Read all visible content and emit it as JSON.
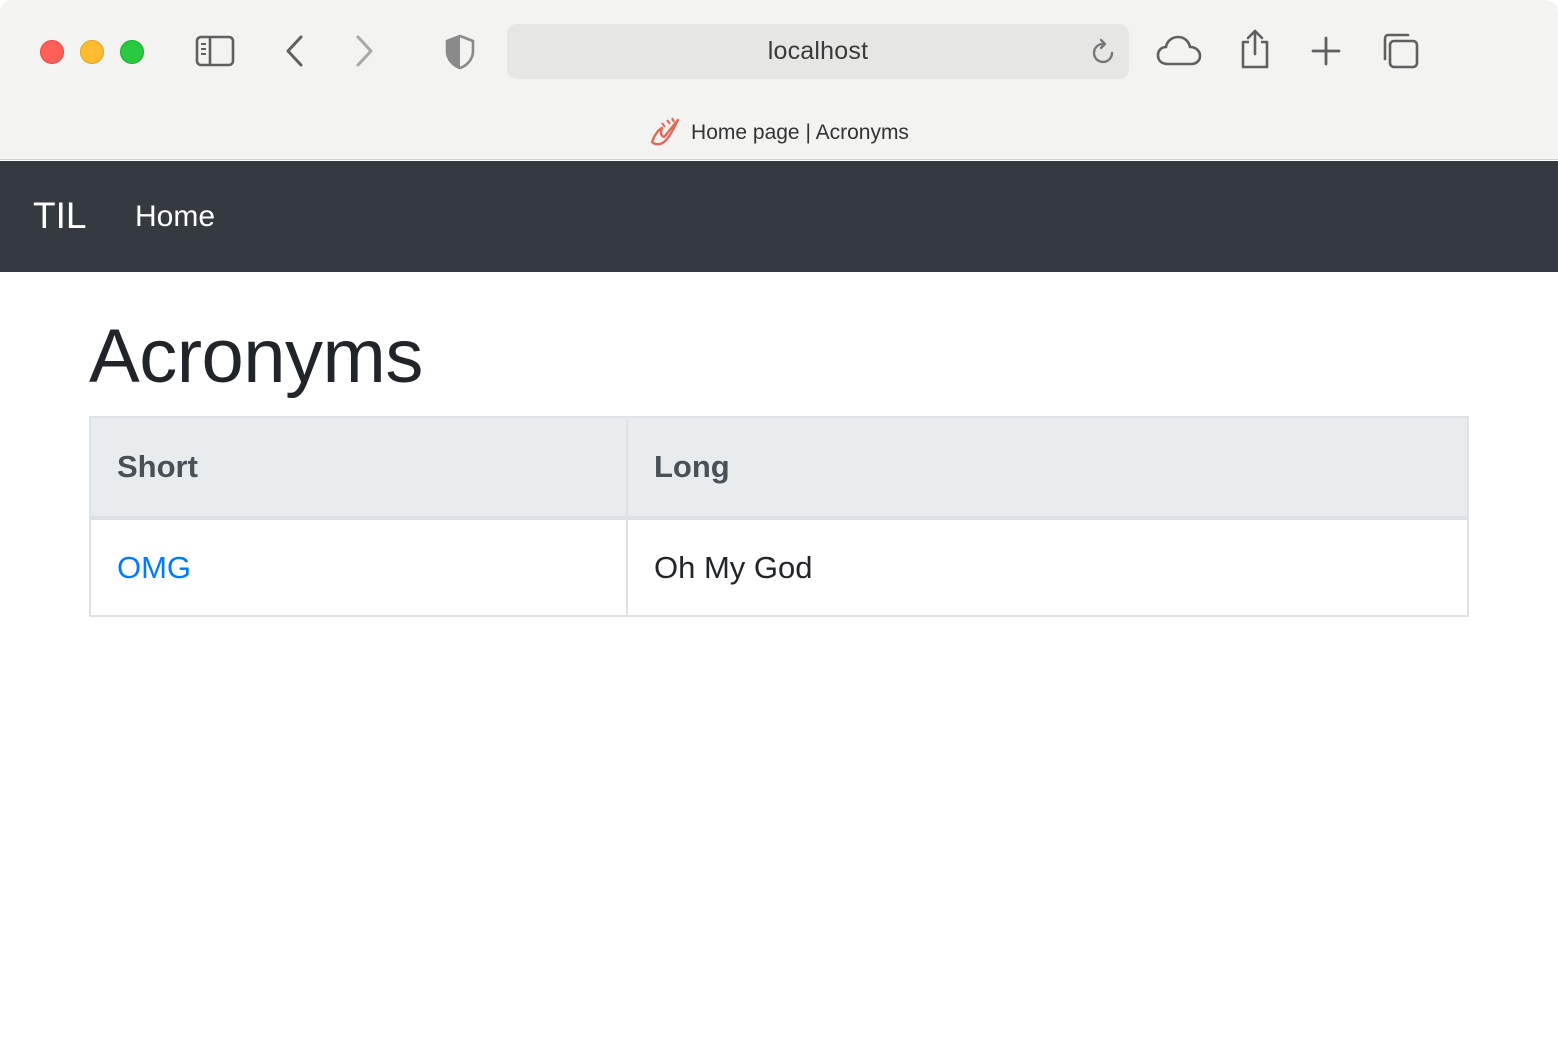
{
  "browser": {
    "address": "localhost",
    "tab_title": "Home page | Acronyms"
  },
  "navbar": {
    "brand": "TIL",
    "links": [
      {
        "label": "Home"
      }
    ],
    "background": "#343a40"
  },
  "main": {
    "title": "Acronyms",
    "table": {
      "headers": [
        "Short",
        "Long"
      ],
      "rows": [
        {
          "short": "OMG",
          "long": "Oh My God"
        }
      ]
    }
  },
  "colors": {
    "link": "#007bff",
    "header_bg": "#e9ecef"
  }
}
